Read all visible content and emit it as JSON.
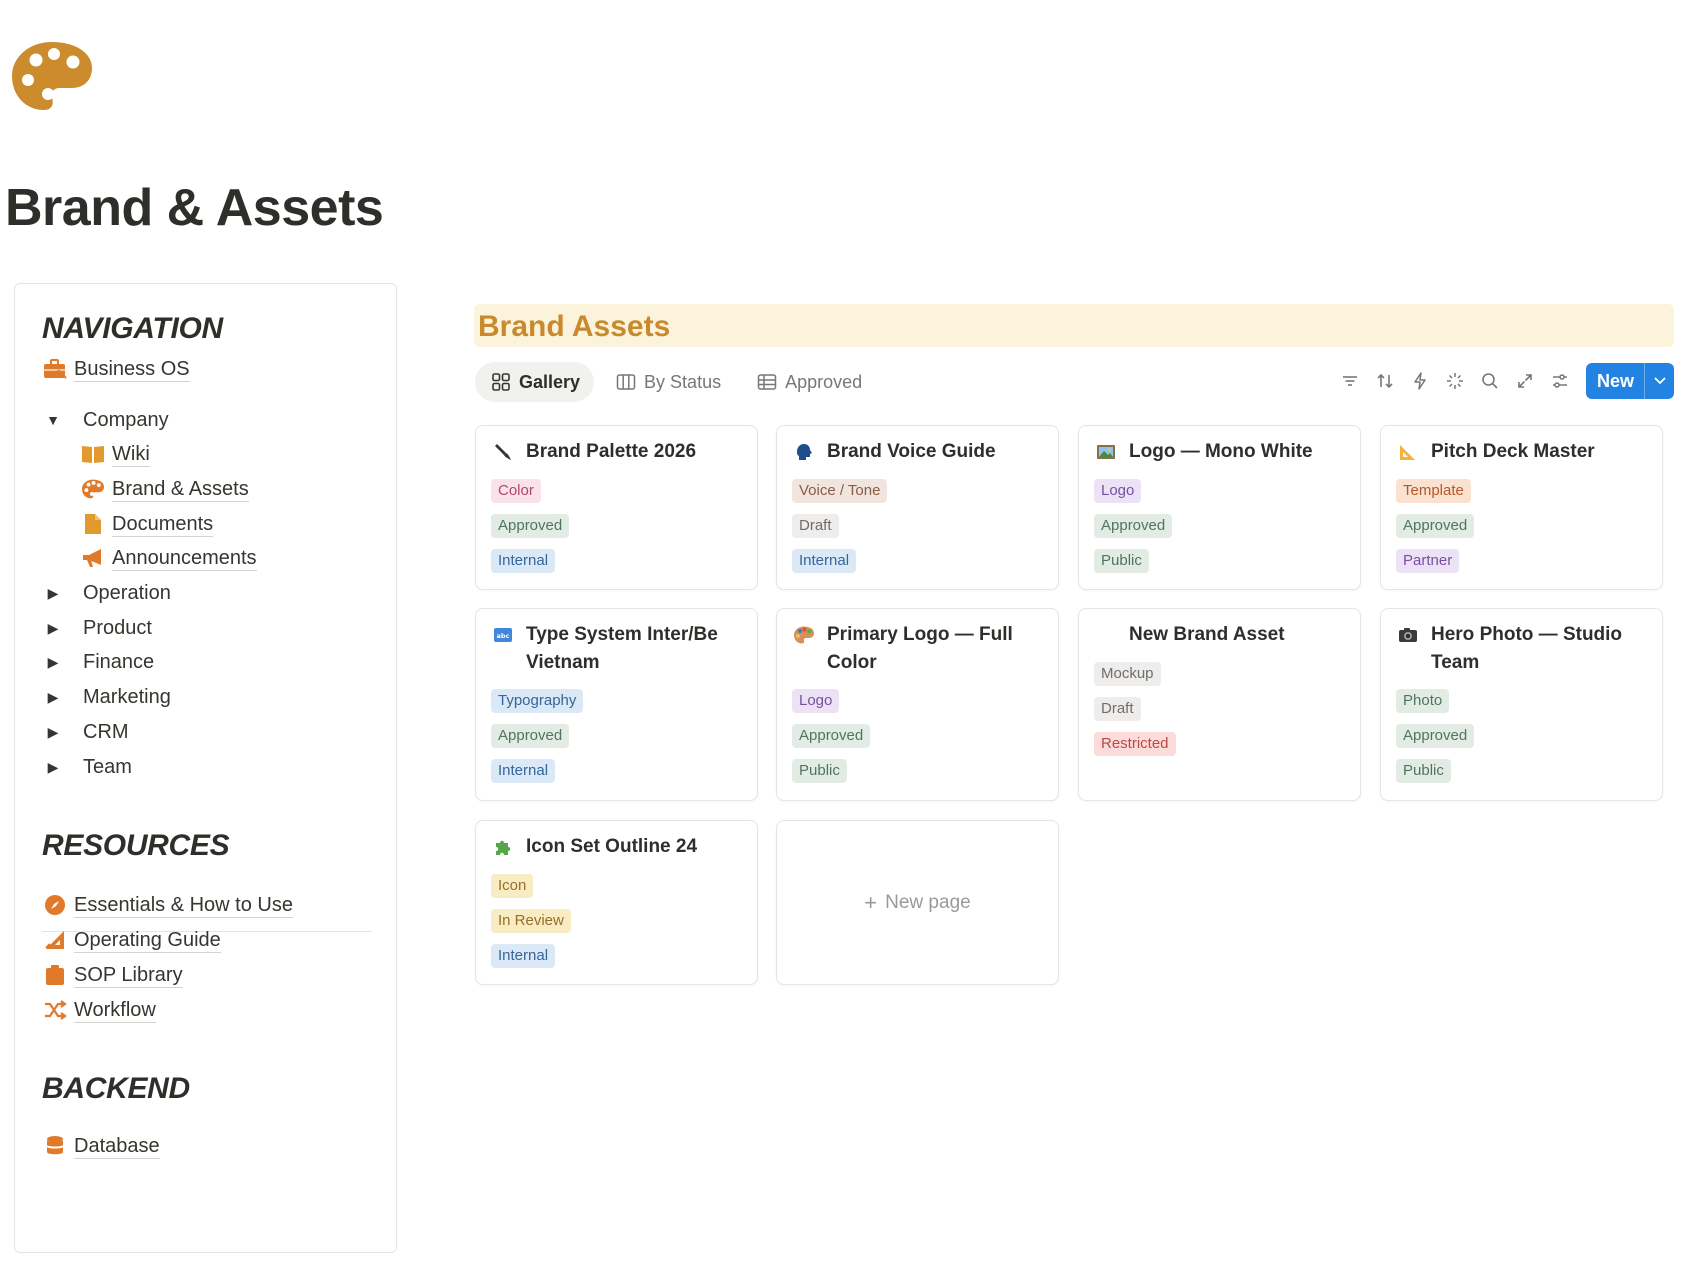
{
  "page": {
    "title": "Brand & Assets",
    "icon": "palette-icon",
    "icon_color": "#cc8b2d"
  },
  "sidebar": {
    "navigation_title": "NAVIGATION",
    "business_os": "Business OS",
    "company": "Company",
    "company_children": [
      "Wiki",
      "Brand & Assets",
      "Documents",
      "Announcements"
    ],
    "groups": [
      "Operation",
      "Product",
      "Finance",
      "Marketing",
      "CRM",
      "Team"
    ],
    "resources_title": "RESOURCES",
    "resources": [
      "Essentials & How to Use",
      "Operating Guide",
      "SOP Library",
      "Workflow"
    ],
    "backend_title": "BACKEND",
    "backend": [
      "Database"
    ],
    "accent_color": "#e07a2a"
  },
  "database": {
    "title": "Brand Assets",
    "views": [
      {
        "label": "Gallery",
        "icon": "gallery-icon",
        "active": true
      },
      {
        "label": "By Status",
        "icon": "board-icon",
        "active": false
      },
      {
        "label": "Approved",
        "icon": "table-icon",
        "active": false
      }
    ],
    "toolbar": {
      "icons": [
        "filter-icon",
        "sort-icon",
        "automation-icon",
        "ai-icon",
        "search-icon",
        "expand-icon",
        "settings-icon"
      ],
      "new_label": "New"
    },
    "tag_colors": {
      "pink": {
        "bg": "#f9e2e9",
        "fg": "#b5466c"
      },
      "green": {
        "bg": "#e2ece5",
        "fg": "#4f7560"
      },
      "blue": {
        "bg": "#dbe9f7",
        "fg": "#33669c"
      },
      "brown": {
        "bg": "#f1e5df",
        "fg": "#8c5b43"
      },
      "gray": {
        "bg": "#eeedeb",
        "fg": "#6f6e69"
      },
      "purple": {
        "bg": "#ebe3f5",
        "fg": "#7a4fa3"
      },
      "orange": {
        "bg": "#fbe1cf",
        "fg": "#b5592a"
      },
      "yellow": {
        "bg": "#f8ecc5",
        "fg": "#9a6e22"
      },
      "red": {
        "bg": "#fbdcdb",
        "fg": "#b84a45"
      }
    },
    "cards": [
      {
        "title": "Brand Palette 2026",
        "icon": "paintbrush-icon",
        "tags": [
          {
            "label": "Color",
            "color": "pink"
          },
          {
            "label": "Approved",
            "color": "green"
          },
          {
            "label": "Internal",
            "color": "blue"
          }
        ]
      },
      {
        "title": "Brand Voice Guide",
        "icon": "speaking-head-icon",
        "tags": [
          {
            "label": "Voice / Tone",
            "color": "brown"
          },
          {
            "label": "Draft",
            "color": "gray"
          },
          {
            "label": "Internal",
            "color": "blue"
          }
        ]
      },
      {
        "title": "Logo — Mono White",
        "icon": "framed-picture-icon",
        "tags": [
          {
            "label": "Logo",
            "color": "purple"
          },
          {
            "label": "Approved",
            "color": "green"
          },
          {
            "label": "Public",
            "color": "green"
          }
        ]
      },
      {
        "title": "Pitch Deck Master",
        "icon": "triangle-ruler-icon",
        "tags": [
          {
            "label": "Template",
            "color": "orange"
          },
          {
            "label": "Approved",
            "color": "green"
          },
          {
            "label": "Partner",
            "color": "purple"
          }
        ]
      },
      {
        "title": "Type System Inter/Be Vietnam",
        "icon": "abc-icon",
        "tags": [
          {
            "label": "Typography",
            "color": "blue"
          },
          {
            "label": "Approved",
            "color": "green"
          },
          {
            "label": "Internal",
            "color": "blue"
          }
        ]
      },
      {
        "title": "Primary Logo — Full Color",
        "icon": "palette-icon",
        "tags": [
          {
            "label": "Logo",
            "color": "purple"
          },
          {
            "label": "Approved",
            "color": "green"
          },
          {
            "label": "Public",
            "color": "green"
          }
        ]
      },
      {
        "title": "New Brand Asset",
        "icon": "",
        "tags": [
          {
            "label": "Mockup",
            "color": "gray"
          },
          {
            "label": "Draft",
            "color": "gray"
          },
          {
            "label": "Restricted",
            "color": "red"
          }
        ]
      },
      {
        "title": "Hero Photo — Studio Team",
        "icon": "camera-icon",
        "tags": [
          {
            "label": "Photo",
            "color": "green"
          },
          {
            "label": "Approved",
            "color": "green"
          },
          {
            "label": "Public",
            "color": "green"
          }
        ]
      },
      {
        "title": "Icon Set Outline 24",
        "icon": "puzzle-icon",
        "tags": [
          {
            "label": "Icon",
            "color": "yellow"
          },
          {
            "label": "In Review",
            "color": "yellow"
          },
          {
            "label": "Internal",
            "color": "blue"
          }
        ]
      }
    ],
    "new_page_label": "New page"
  }
}
